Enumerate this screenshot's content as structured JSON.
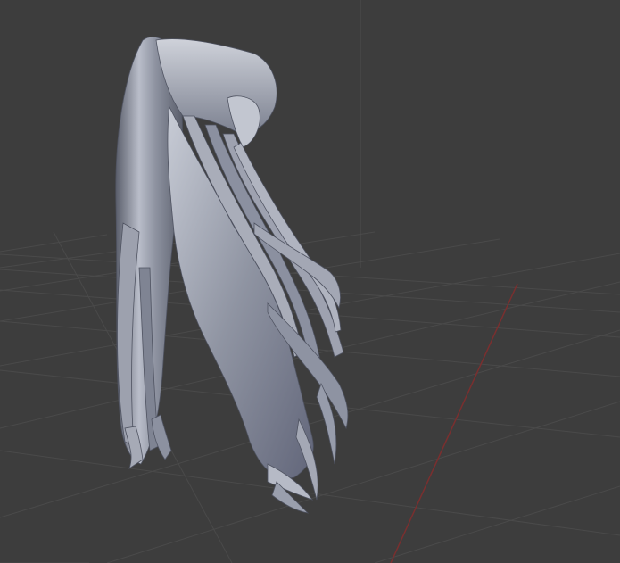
{
  "viewport": {
    "background_color": "#3d3d3d",
    "grid_color": "#4c4c4c",
    "x_axis_color": "#7a2f2f",
    "model": {
      "name": "long-hair-mesh",
      "shading": "matcap-clay",
      "base_color": "#9095a3",
      "highlight_color": "#d6d9e2",
      "shadow_color": "#5a5e6b"
    }
  }
}
